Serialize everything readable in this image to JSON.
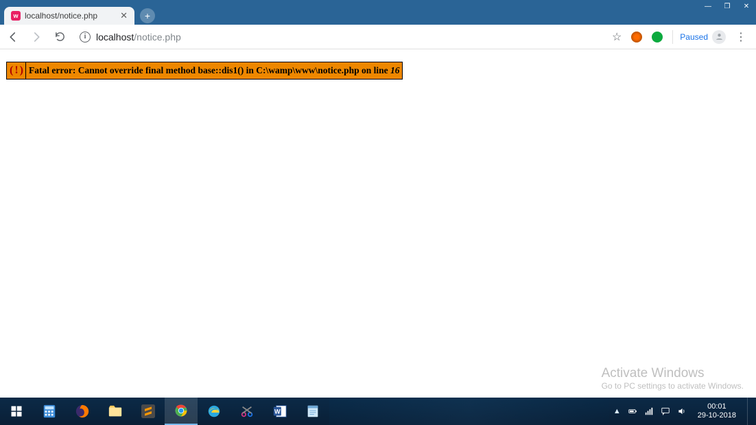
{
  "window": {
    "minimize": "—",
    "maximize": "❐",
    "close": "✕"
  },
  "tab": {
    "title": "localhost/notice.php",
    "favicon_letter": "w"
  },
  "address": {
    "host": "localhost",
    "path": "/notice.php",
    "paused_label": "Paused"
  },
  "error": {
    "bang": "( ! )",
    "prefix": "Fatal error: ",
    "message": "Cannot override final method base::dis1() in C:\\wamp\\www\\notice.php on line ",
    "line": "16"
  },
  "watermark": {
    "title": "Activate Windows",
    "sub": "Go to PC settings to activate Windows."
  },
  "tray": {
    "up": "▲"
  },
  "clock": {
    "time": "00:01",
    "date": "29-10-2018"
  }
}
